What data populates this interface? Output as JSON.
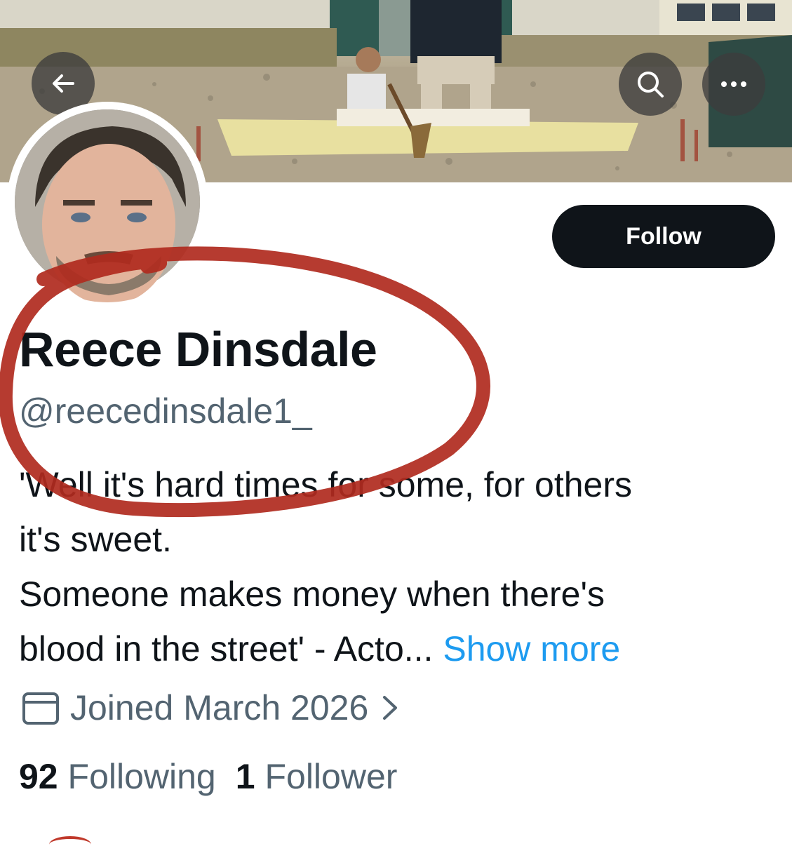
{
  "header": {
    "back_icon": "arrow-left-icon",
    "search_icon": "search-icon",
    "more_icon": "more-horizontal-icon"
  },
  "profile": {
    "display_name": "Reece Dinsdale",
    "handle": "@reecedinsdale1_",
    "follow_label": "Follow",
    "bio": {
      "line1": "'Well it's hard times for some, for others",
      "line2": "it's sweet.",
      "line3": "Someone makes money when there's",
      "line4": "blood in the street' - Acto...",
      "show_more": "Show more"
    },
    "joined": "Joined March 2026",
    "joined_icon": "calendar-icon",
    "stats": {
      "following_count": "92",
      "following_label": "Following",
      "followers_count": "1",
      "followers_label": "Follower"
    }
  },
  "colors": {
    "follow_button": "#0f1419",
    "secondary_text": "#536471",
    "link": "#1d9bf0",
    "annotation_circle": "#b02a1e"
  }
}
